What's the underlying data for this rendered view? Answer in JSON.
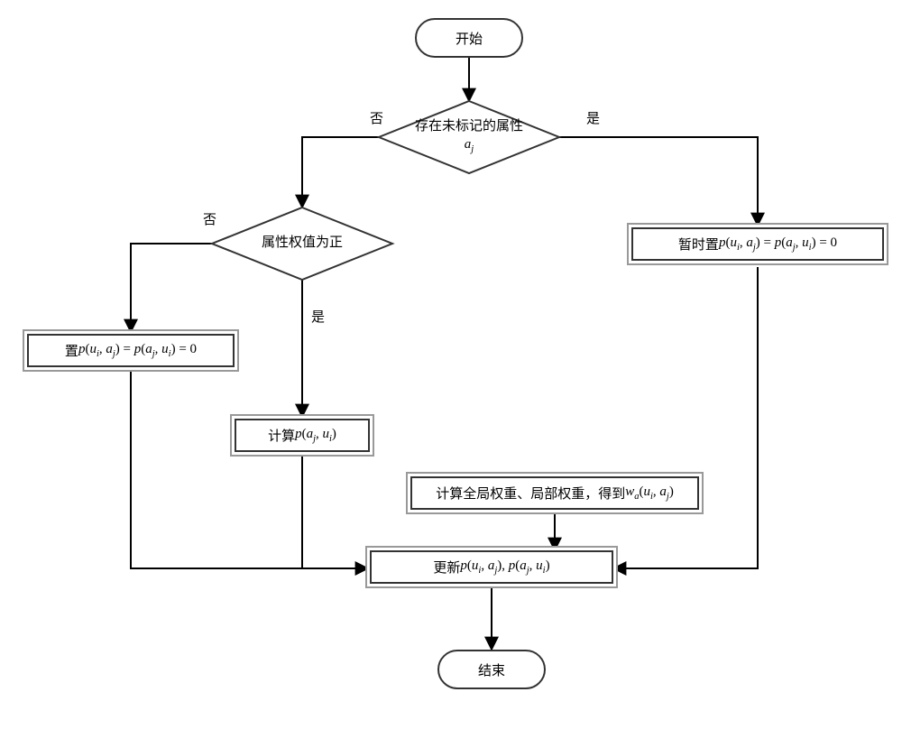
{
  "chart_data": {
    "type": "flowchart",
    "nodes": [
      {
        "id": "start",
        "type": "terminator",
        "label": "开始"
      },
      {
        "id": "d1",
        "type": "decision",
        "label_line1": "存在未标记的属性",
        "math_var": "a",
        "math_sub": "j"
      },
      {
        "id": "d2",
        "type": "decision",
        "label": "属性权值为正"
      },
      {
        "id": "p_temp",
        "type": "process",
        "prefix": "暂时置",
        "expr": "p(uᵢ,aⱼ)=p(aⱼ,uᵢ)=0"
      },
      {
        "id": "p_set0",
        "type": "process",
        "prefix": "置",
        "expr": "p(uᵢ,aⱼ)=p(aⱼ,uᵢ)=0"
      },
      {
        "id": "p_calc",
        "type": "process",
        "prefix": "计算",
        "expr": "p(aⱼ,uᵢ)"
      },
      {
        "id": "p_weight",
        "type": "process",
        "text": "计算全局权重、局部权重，得到",
        "expr_var": "w",
        "expr_sub": "a",
        "expr_args": "(uᵢ,aⱼ)"
      },
      {
        "id": "p_update",
        "type": "process",
        "prefix": "更新",
        "expr": "p(uᵢ,aⱼ), p(aⱼ,uᵢ)"
      },
      {
        "id": "end",
        "type": "terminator",
        "label": "结束"
      }
    ],
    "edges": [
      {
        "from": "start",
        "to": "d1"
      },
      {
        "from": "d1",
        "to": "d2",
        "label": "否"
      },
      {
        "from": "d1",
        "to": "p_temp",
        "label": "是"
      },
      {
        "from": "d2",
        "to": "p_set0",
        "label": "否"
      },
      {
        "from": "d2",
        "to": "p_calc",
        "label": "是"
      },
      {
        "from": "p_calc",
        "to": "p_update"
      },
      {
        "from": "p_weight",
        "to": "p_update"
      },
      {
        "from": "p_set0",
        "to": "p_update"
      },
      {
        "from": "p_temp",
        "to": "p_update"
      },
      {
        "from": "p_update",
        "to": "end"
      }
    ]
  },
  "labels": {
    "start": "开始",
    "end": "结束",
    "d1_line1": "存在未标记的属性",
    "d2_text": "属性权值为正",
    "yes": "是",
    "no": "否",
    "temp_prefix": "暂时置 ",
    "set_prefix": "置 ",
    "calc_prefix": "计算",
    "update_prefix": "更新",
    "weight_text": "计算全局权重、局部权重，得到"
  }
}
